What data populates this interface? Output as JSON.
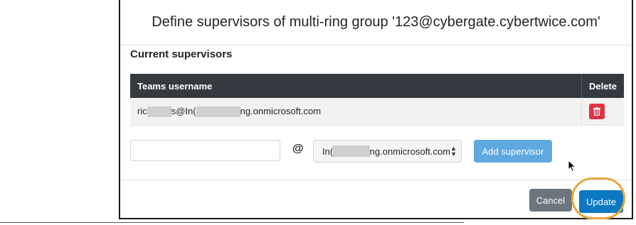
{
  "modal": {
    "title": "Define supervisors of multi-ring group '123@cybergate.cybertwice.com'",
    "section_title": "Current supervisors"
  },
  "table": {
    "columns": [
      "Teams username",
      "Delete"
    ],
    "rows": [
      {
        "username_start": "ric",
        "username_mid": "s@In(",
        "username_end": "ng.onmicrosoft.com",
        "delete_icon": "trash-icon"
      }
    ]
  },
  "form": {
    "username_value": "",
    "at_sign": "@",
    "domain_start": "In(",
    "domain_end": "ng.onmicrosoft.com",
    "add_label": "Add supervisor"
  },
  "footer": {
    "cancel_label": "Cancel",
    "update_label": "Update"
  },
  "colors": {
    "header_dark": "#343a40",
    "delete_red": "#dc3545",
    "add_blue": "#5fa8e0",
    "update_blue": "#0b78c4",
    "cancel_gray": "#6c757d",
    "highlight_orange": "#e8a53a"
  }
}
